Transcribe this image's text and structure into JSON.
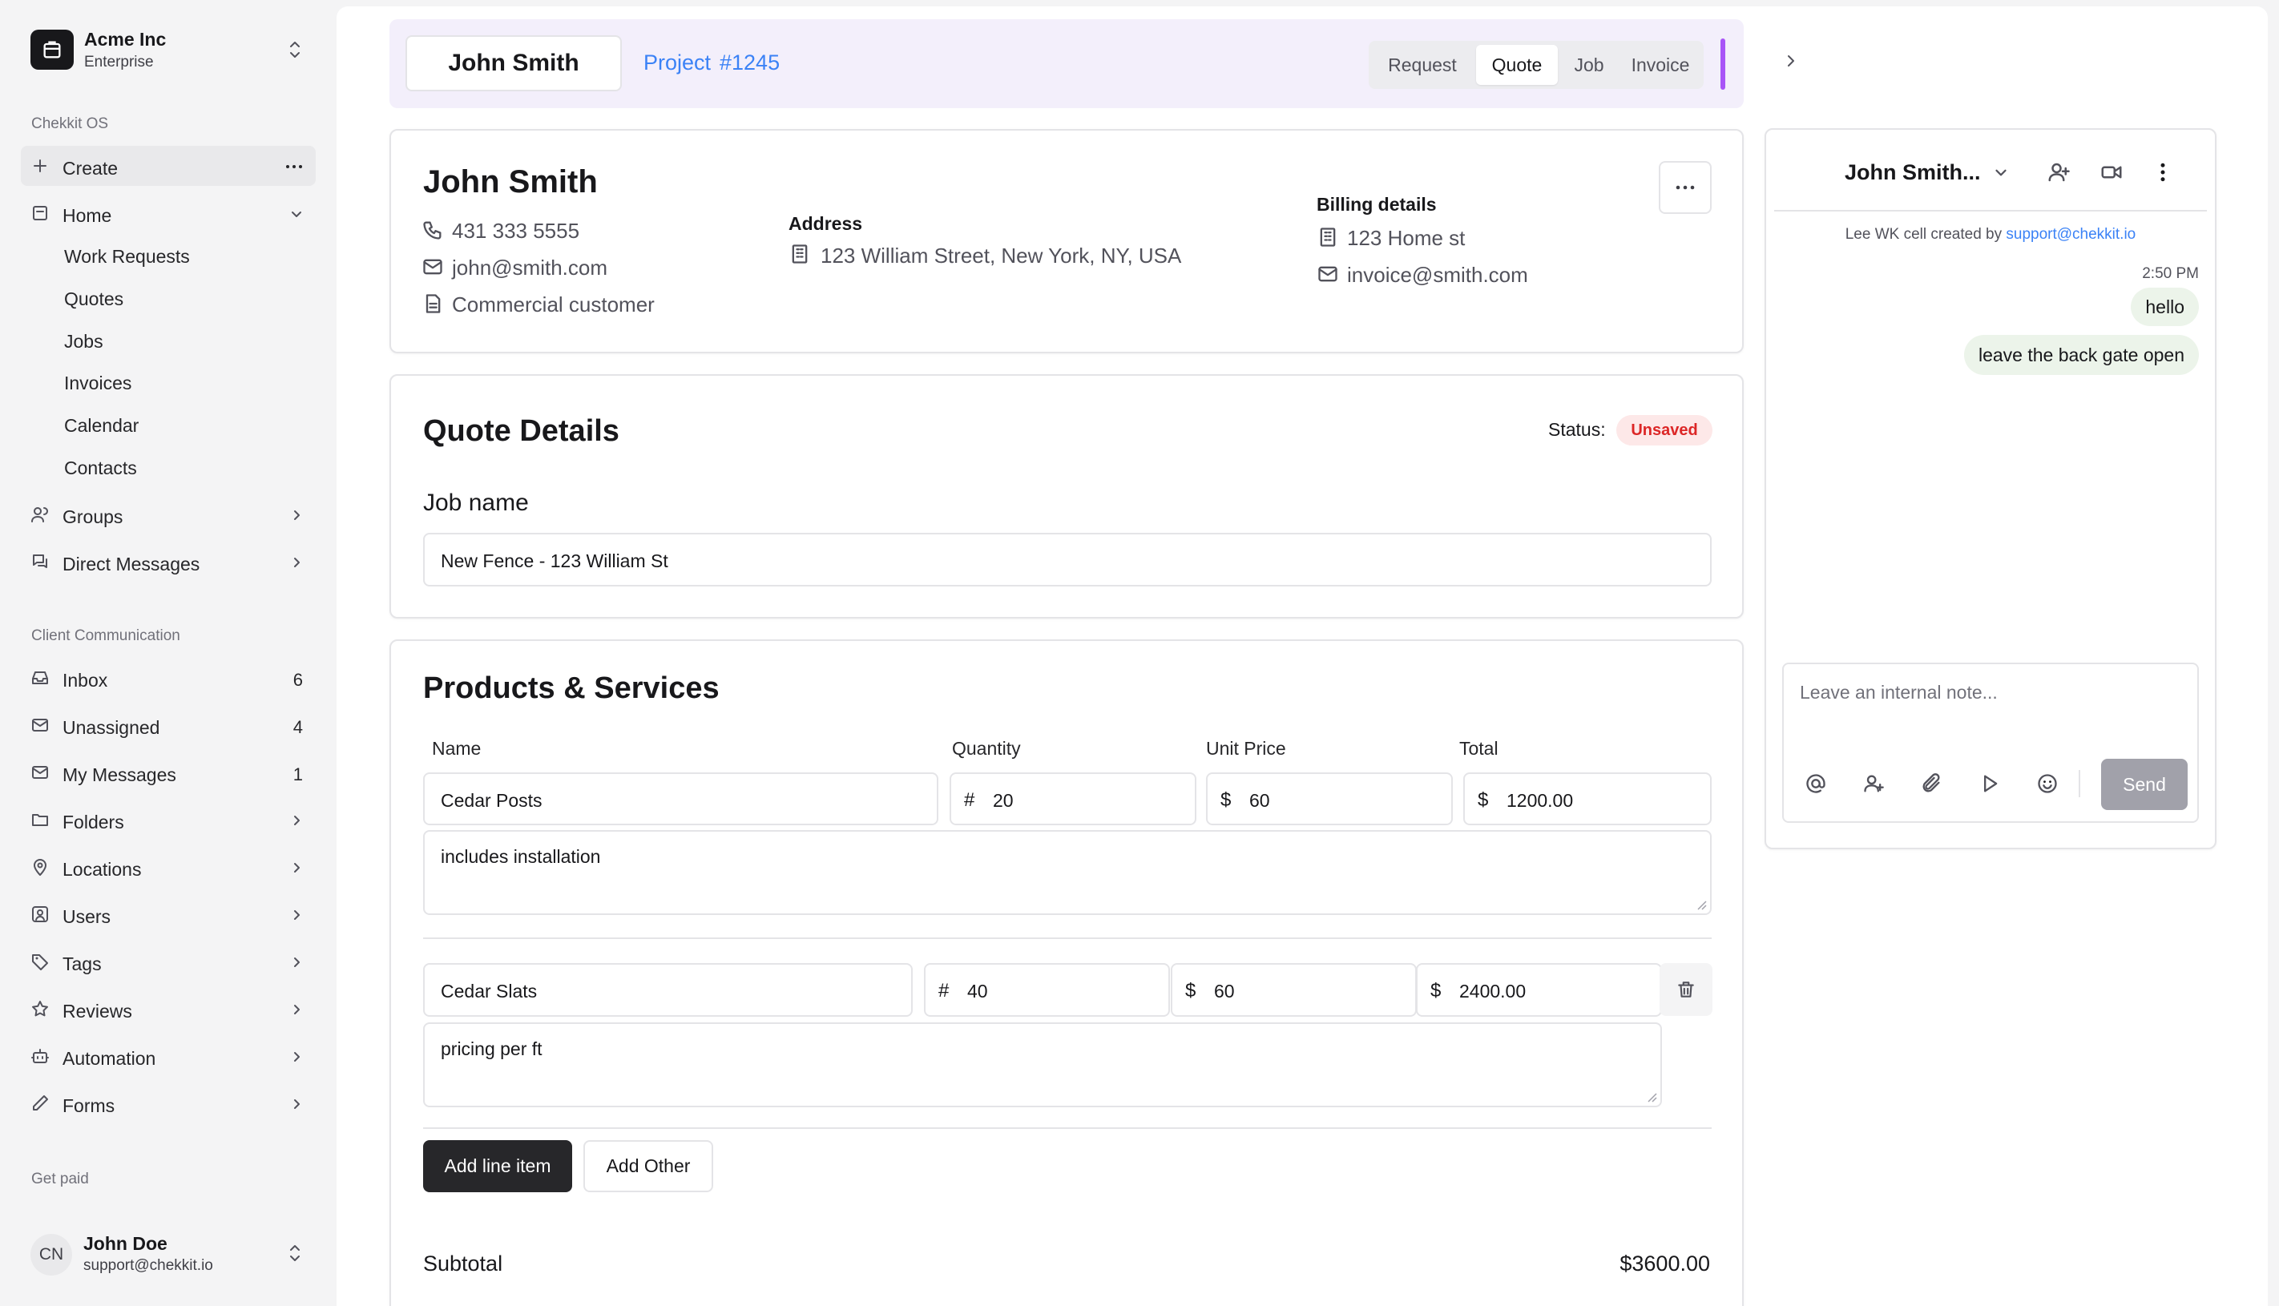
{
  "org": {
    "name": "Acme Inc",
    "plan": "Enterprise"
  },
  "sidebar": {
    "section_os": "Chekkit OS",
    "create_label": "Create",
    "home_label": "Home",
    "home_items": [
      "Work Requests",
      "Quotes",
      "Jobs",
      "Invoices",
      "Calendar",
      "Contacts"
    ],
    "groups_label": "Groups",
    "dm_label": "Direct Messages",
    "section_client": "Client Communication",
    "client_items": [
      {
        "label": "Inbox",
        "count": "6",
        "icon": "inbox-icon"
      },
      {
        "label": "Unassigned",
        "count": "4",
        "icon": "mail-icon"
      },
      {
        "label": "My Messages",
        "count": "1",
        "icon": "mail-icon"
      },
      {
        "label": "Folders",
        "icon": "folder-icon"
      },
      {
        "label": "Locations",
        "icon": "map-pin-icon"
      },
      {
        "label": "Users",
        "icon": "user-square-icon"
      },
      {
        "label": "Tags",
        "icon": "tag-icon"
      },
      {
        "label": "Reviews",
        "icon": "star-icon"
      },
      {
        "label": "Automation",
        "icon": "bot-icon"
      },
      {
        "label": "Forms",
        "icon": "pencil-icon"
      }
    ],
    "section_paid": "Get paid",
    "user": {
      "initials": "CN",
      "name": "John Doe",
      "email": "support@chekkit.io"
    }
  },
  "topbar": {
    "client_name": "John Smith",
    "project_label": "Project",
    "project_number": "#1245",
    "tabs": [
      "Request",
      "Quote",
      "Job",
      "Invoice"
    ],
    "active_tab": "Quote"
  },
  "customer": {
    "name": "John Smith",
    "phone": "431 333 5555",
    "email": "john@smith.com",
    "type": "Commercial customer",
    "address_label": "Address",
    "address": "123 William Street, New York, NY, USA",
    "billing_label": "Billing details",
    "billing_address": "123 Home st",
    "billing_email": "invoice@smith.com"
  },
  "quote": {
    "title": "Quote Details",
    "status_label": "Status:",
    "status": "Unsaved",
    "job_name_label": "Job name",
    "job_name": "New Fence - 123 William St"
  },
  "products": {
    "title": "Products & Services",
    "columns": [
      "Name",
      "Quantity",
      "Unit Price",
      "Total"
    ],
    "items": [
      {
        "name": "Cedar Posts",
        "qty": "20",
        "price": "60",
        "total": "1200.00",
        "note": "includes installation"
      },
      {
        "name": "Cedar Slats",
        "qty": "40",
        "price": "60",
        "total": "2400.00",
        "note": "pricing per ft"
      }
    ],
    "qty_prefix": "#",
    "price_prefix": "$",
    "add_line_label": "Add line item",
    "add_other_label": "Add Other",
    "subtotal_label": "Subtotal",
    "subtotal": "$3600.00"
  },
  "chat": {
    "title": "John Smith...",
    "system_prefix": "Lee WK cell created by",
    "system_link": "support@chekkit.io",
    "time": "2:50 PM",
    "messages": [
      "hello",
      "leave the back gate open"
    ],
    "note_placeholder": "Leave an internal note...",
    "send_label": "Send"
  },
  "colors": {
    "accent_purple": "#a855f7",
    "link_blue": "#3b82f6",
    "status_red": "#dc2626",
    "bubble_green": "#ecf4ea"
  }
}
